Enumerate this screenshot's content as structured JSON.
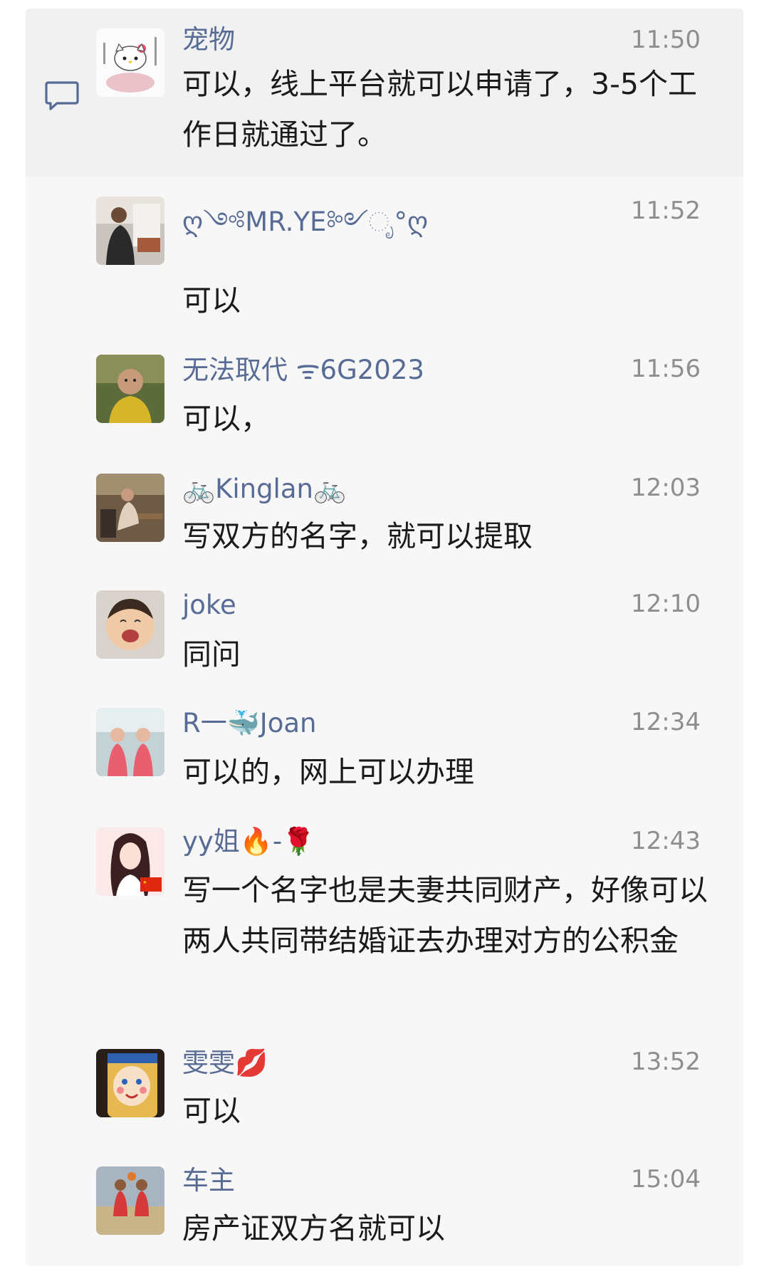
{
  "messages": [
    {
      "name": "宠物",
      "time": "11:50",
      "text": "可以，线上平台就可以申请了，3-5个工作日就通过了。",
      "avatar": "hello-kitty-lotus-avatar"
    },
    {
      "name": "ღ༺MR.YE༻ೃ°ღ",
      "time": "11:52",
      "text": "可以",
      "avatar": "man-in-cafe-avatar"
    },
    {
      "name": "无法取代 ᯤ6G2023",
      "time": "11:56",
      "text": "可以，",
      "avatar": "child-yellow-shirt-avatar"
    },
    {
      "name": "🚲Kinglan🚲",
      "time": "12:03",
      "text": "写双方的名字，就可以提取",
      "avatar": "woman-at-table-avatar"
    },
    {
      "name": "joke",
      "time": "12:10",
      "text": "同问",
      "avatar": "crying-baby-avatar"
    },
    {
      "name": "R一🐳Joan",
      "time": "12:34",
      "text": "可以的，网上可以办理",
      "avatar": "two-girls-avatar"
    },
    {
      "name": "yy姐🔥-🌹",
      "time": "12:43",
      "text": "写一个名字也是夫妻共同财产，好像可以两人共同带结婚证去办理对方的公积金",
      "avatar": "anime-girl-flag-avatar"
    },
    {
      "name": "雯雯💋",
      "time": "13:52",
      "text": "可以",
      "avatar": "cartoon-face-avatar"
    },
    {
      "name": "车主",
      "time": "15:04",
      "text": "房产证双方名就可以",
      "avatar": "basketball-players-avatar"
    }
  ],
  "colors": {
    "name": "#576b95",
    "time": "#8e8e8e",
    "text": "#1a1a1a",
    "background": "#f7f7f7"
  }
}
